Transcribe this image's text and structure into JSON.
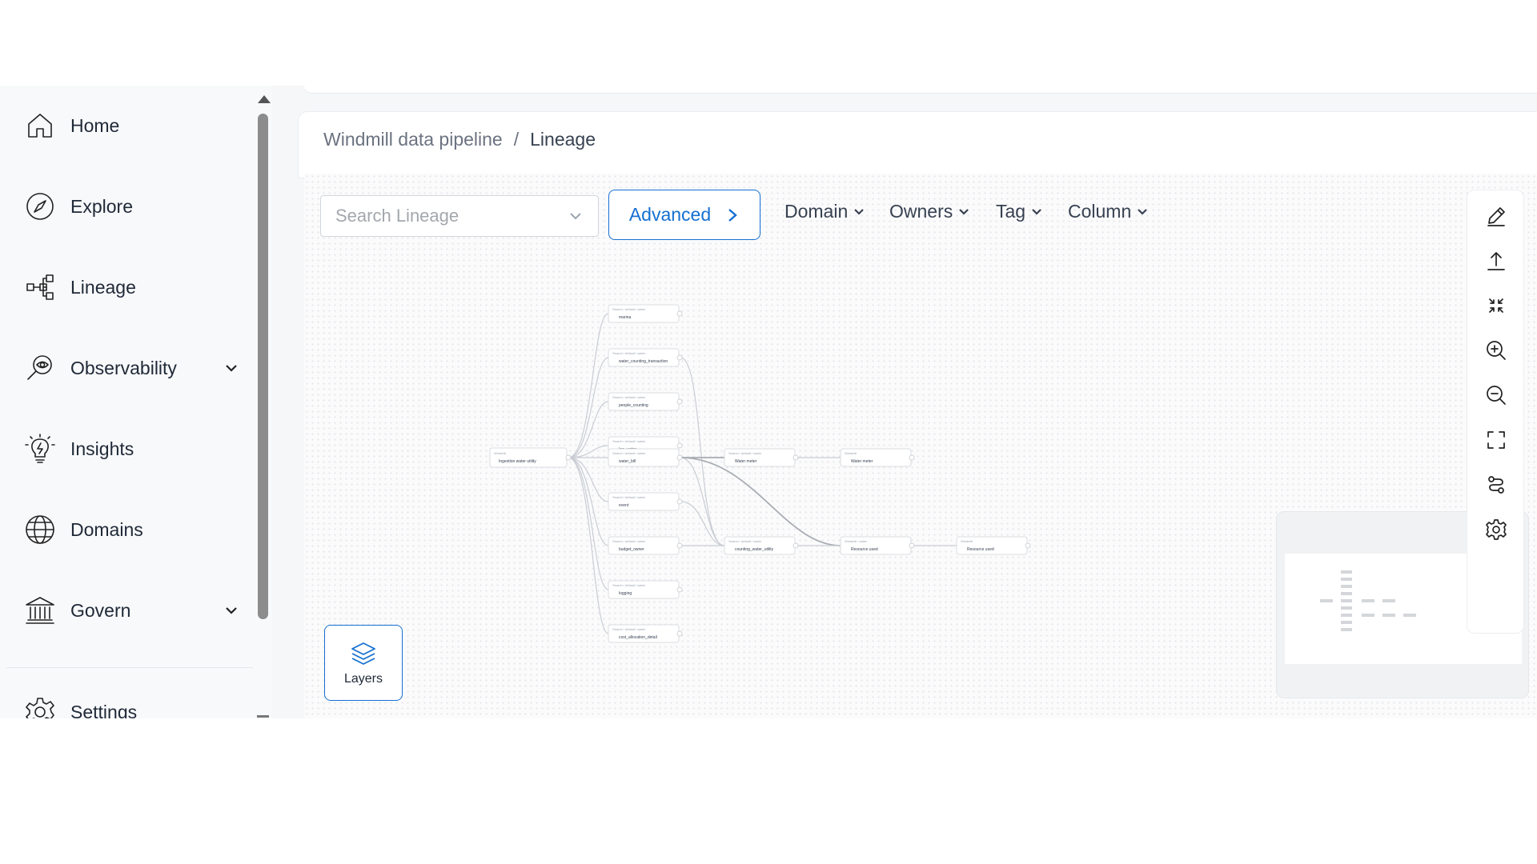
{
  "sidebar": {
    "items": [
      {
        "label": "Home",
        "icon": "home-icon"
      },
      {
        "label": "Explore",
        "icon": "compass-icon"
      },
      {
        "label": "Lineage",
        "icon": "lineage-icon"
      },
      {
        "label": "Observability",
        "icon": "observability-icon",
        "expandable": true
      },
      {
        "label": "Insights",
        "icon": "lightbulb-icon"
      },
      {
        "label": "Domains",
        "icon": "globe-icon"
      },
      {
        "label": "Govern",
        "icon": "bank-icon",
        "expandable": true
      },
      {
        "label": "Settings",
        "icon": "gear-icon"
      }
    ]
  },
  "breadcrumb": {
    "parent": "Windmill data pipeline",
    "separator": "/",
    "current": "Lineage"
  },
  "toolbar": {
    "search_placeholder": "Search Lineage",
    "advanced_label": "Advanced",
    "filters": [
      "Domain",
      "Owners",
      "Tag",
      "Column"
    ]
  },
  "canvas_tools": [
    "edit-icon",
    "export-icon",
    "collapse-icon",
    "zoom-in-icon",
    "zoom-out-icon",
    "fit-view-icon",
    "lineage-mode-icon",
    "settings-icon"
  ],
  "layers": {
    "label": "Layers"
  },
  "accent_color": "#1570d1"
}
